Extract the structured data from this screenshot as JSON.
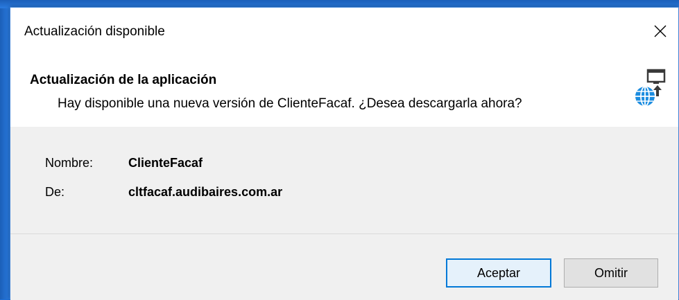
{
  "window": {
    "title": "Actualización disponible"
  },
  "header": {
    "title": "Actualización de la aplicación",
    "description": "Hay disponible una nueva versión de ClienteFacaf. ¿Desea descargarla ahora?",
    "icon": "globe-monitor-update-icon"
  },
  "details": {
    "name_label": "Nombre:",
    "name_value": "ClienteFacaf",
    "from_label": "De:",
    "from_value": "cltfacaf.audibaires.com.ar"
  },
  "buttons": {
    "accept_label": "Aceptar",
    "skip_label": "Omitir"
  },
  "colors": {
    "accent": "#0078d7",
    "desktop": "#1e6fd6",
    "panel": "#f0f0f0"
  }
}
